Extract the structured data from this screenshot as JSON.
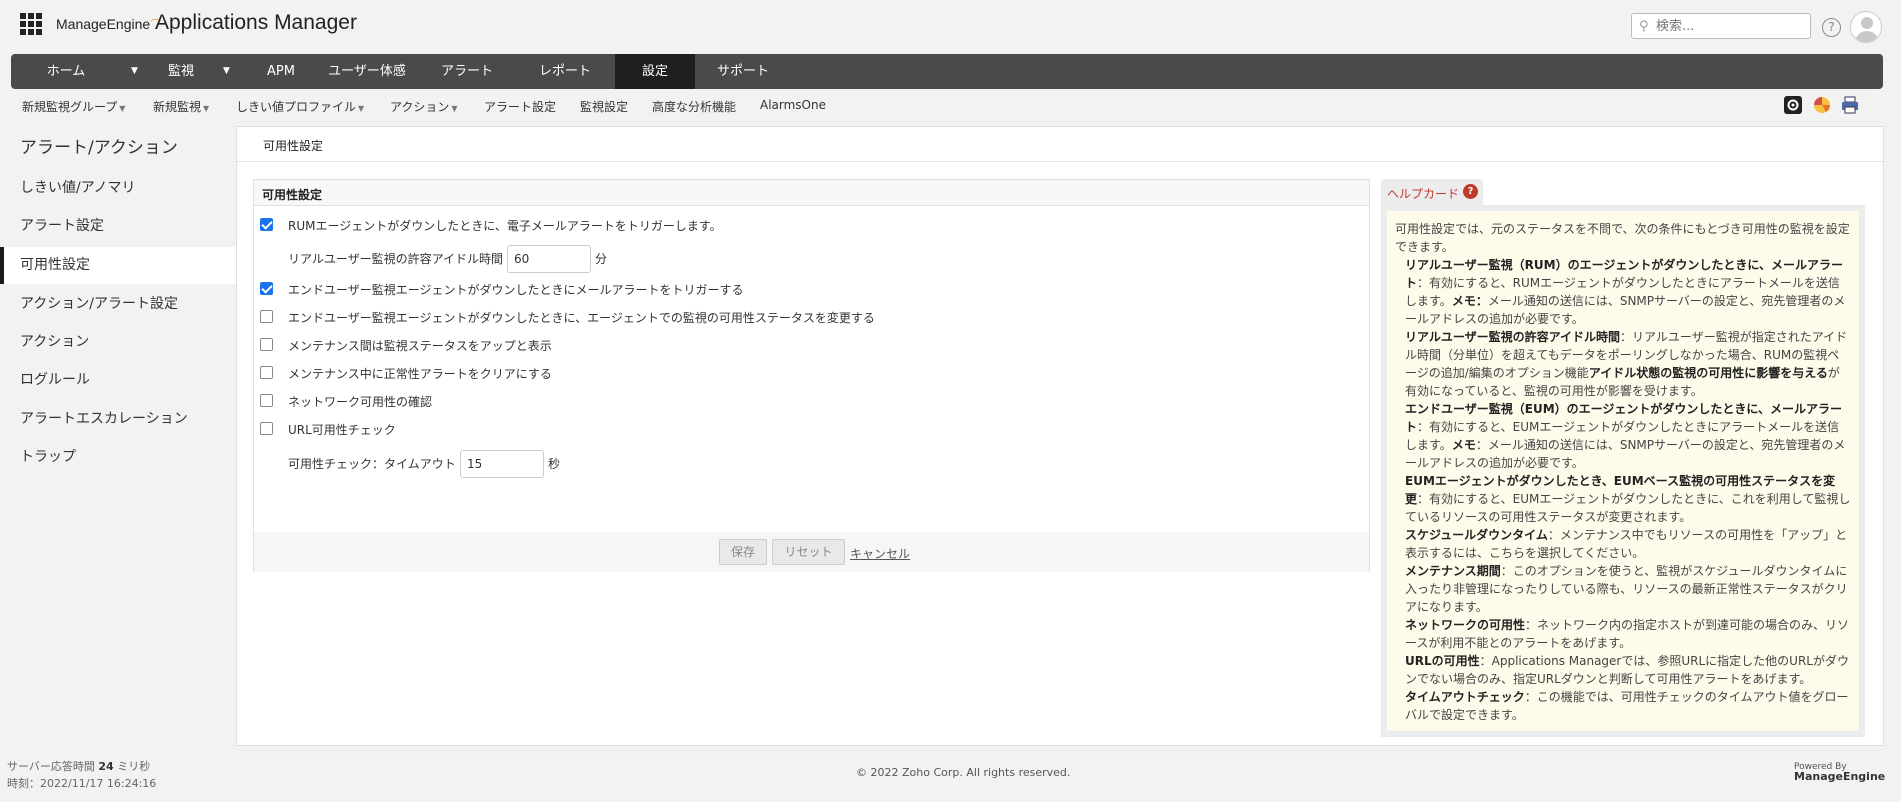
{
  "header": {
    "logo_text": "ManageEngine",
    "app_title": "Applications Manager",
    "search_placeholder": "検索...",
    "help_symbol": "?"
  },
  "main_nav": {
    "items": [
      {
        "label": "ホーム",
        "has_dropdown": true
      },
      {
        "label": "監視",
        "has_dropdown": true
      },
      {
        "label": "APM",
        "has_dropdown": false
      },
      {
        "label": "ユーザー体感",
        "has_dropdown": false
      },
      {
        "label": "アラート",
        "has_dropdown": false
      },
      {
        "label": "レポート",
        "has_dropdown": false
      },
      {
        "label": "設定",
        "has_dropdown": false,
        "active": true
      },
      {
        "label": "サポート",
        "has_dropdown": false
      }
    ]
  },
  "sub_nav": {
    "items": [
      {
        "label": "新規監視グループ",
        "has_dropdown": true
      },
      {
        "label": "新規監視",
        "has_dropdown": true
      },
      {
        "label": "しきい値プロファイル",
        "has_dropdown": true
      },
      {
        "label": "アクション",
        "has_dropdown": true
      },
      {
        "label": "アラート設定",
        "has_dropdown": false
      },
      {
        "label": "監視設定",
        "has_dropdown": false
      },
      {
        "label": "高度な分析機能",
        "has_dropdown": false
      },
      {
        "label": "AlarmsOne",
        "has_dropdown": false
      }
    ],
    "tool_icons": [
      "settings-icon",
      "chart-icon",
      "print-icon"
    ]
  },
  "left_panel": {
    "title": "アラート/アクション",
    "items": [
      {
        "label": "しきい値/アノマリ"
      },
      {
        "label": "アラート設定"
      },
      {
        "label": "可用性設定",
        "active": true
      },
      {
        "label": "アクション/アラート設定"
      },
      {
        "label": "アクション"
      },
      {
        "label": "ログルール"
      },
      {
        "label": "アラートエスカレーション"
      },
      {
        "label": "トラップ"
      }
    ]
  },
  "content": {
    "header": "可用性設定",
    "form": {
      "title": "可用性設定",
      "options": [
        {
          "label": "RUMエージェントがダウンしたときに、電子メールアラートをトリガーします。",
          "checked": true
        },
        {
          "label": "エンドユーザー監視エージェントがダウンしたときにメールアラートをトリガーする",
          "checked": true
        },
        {
          "label": "エンドユーザー監視エージェントがダウンしたときに、エージェントでの監視の可用性ステータスを変更する",
          "checked": false
        },
        {
          "label": "メンテナンス間は監視ステータスをアップと表示",
          "checked": false
        },
        {
          "label": "メンテナンス中に正常性アラートをクリアにする",
          "checked": false
        },
        {
          "label": "ネットワーク可用性の確認",
          "checked": false
        },
        {
          "label": "URL可用性チェック",
          "checked": false
        }
      ],
      "idle_time": {
        "label": "リアルユーザー監視の許容アイドル時間",
        "value": "60",
        "unit": "分"
      },
      "timeout": {
        "label": "可用性チェック：タイムアウト",
        "value": "15",
        "unit": "秒"
      },
      "buttons": {
        "save": "保存",
        "reset": "リセット",
        "cancel": "キャンセル"
      }
    },
    "help_card": {
      "title": "ヘルプカード",
      "help_symbol": "?",
      "intro": "可用性設定では、元のステータスを不問で、次の条件にもとづき可用性の監視を設定できます。",
      "items": [
        {
          "term": "リアルユーザー監視（RUM）のエージェントがダウンしたときに、メールアラート",
          "desc": "：有効にすると、RUMエージェントがダウンしたときにアラートメールを送信します。",
          "note_term": "メモ：",
          "note": "メール通知の送信には、SNMPサーバーの設定と、宛先管理者のメールアドレスの追加が必要です。"
        },
        {
          "term": "リアルユーザー監視の許容アイドル時間",
          "desc": "：リアルユーザー監視が指定されたアイドル時間（分単位）を超えてもデータをポーリングしなかった場合、RUMの監視ページの追加/編集のオプション機能",
          "note_term": "アイドル状態の監視の可用性に影響を与える",
          "note": "が有効になっていると、監視の可用性が影響を受けます。"
        },
        {
          "term": "エンドユーザー監視（EUM）のエージェントがダウンしたときに、メールアラート",
          "desc": "：有効にすると、EUMエージェントがダウンしたときにアラートメールを送信します。",
          "note_term": "メモ",
          "note": "：メール通知の送信には、SNMPサーバーの設定と、宛先管理者のメールアドレスの追加が必要です。"
        },
        {
          "term": "EUMエージェントがダウンしたとき、EUMベース監視の可用性ステータスを変更",
          "desc": "：有効にすると、EUMエージェントがダウンしたときに、これを利用して監視しているリソースの可用性ステータスが変更されます。",
          "note_term": "",
          "note": ""
        },
        {
          "term": "スケジュールダウンタイム",
          "desc": "：メンテナンス中でもリソースの可用性を「アップ」と表示するには、こちらを選択してください。",
          "note_term": "",
          "note": ""
        },
        {
          "term": "メンテナンス期間",
          "desc": "：このオプションを使うと、監視がスケジュールダウンタイムに入ったり非管理になったりしている際も、リソースの最新正常性ステータスがクリアになります。",
          "note_term": "",
          "note": ""
        },
        {
          "term": "ネットワークの可用性",
          "desc": "：ネットワーク内の指定ホストが到達可能の場合のみ、リソースが利用不能とのアラートをあげます。",
          "note_term": "",
          "note": ""
        },
        {
          "term": "URLの可用性",
          "desc": "：Applications Managerでは、参照URLに指定した他のURLがダウンでない場合のみ、指定URLダウンと判断して可用性アラートをあげます。",
          "note_term": "",
          "note": ""
        },
        {
          "term": "タイムアウトチェック",
          "desc": "：この機能では、可用性チェックのタイムアウト値をグローバルで設定できます。",
          "note_term": "",
          "note": ""
        }
      ]
    }
  },
  "footer": {
    "response_label": "サーバー応答時間",
    "response_value": "24",
    "response_unit": "ミリ秒",
    "time_label": "時刻：2022/11/17 16:24:16",
    "copyright": "© 2022 Zoho Corp.   All rights reserved.",
    "powered_by": "Powered By",
    "brand": "ManageEngine"
  }
}
